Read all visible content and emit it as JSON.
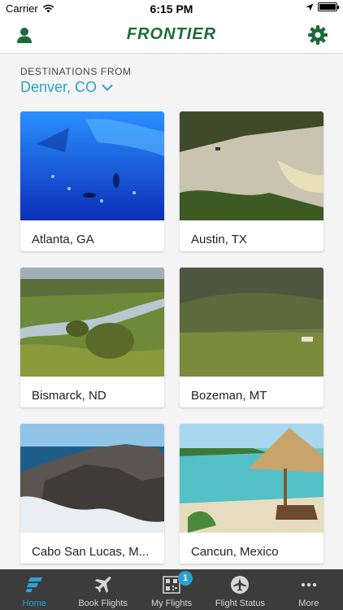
{
  "status_bar": {
    "carrier": "Carrier",
    "time": "6:15 PM"
  },
  "nav": {
    "logo": "FRONTIER"
  },
  "destinations": {
    "from_label": "DESTINATIONS FROM",
    "city": "Denver, CO",
    "cards": [
      {
        "name": "Atlanta, GA"
      },
      {
        "name": "Austin, TX"
      },
      {
        "name": "Bismarck, ND"
      },
      {
        "name": "Bozeman, MT"
      },
      {
        "name": "Cabo San Lucas, M..."
      },
      {
        "name": "Cancun, Mexico"
      }
    ]
  },
  "tabs": [
    {
      "label": "Home"
    },
    {
      "label": "Book Flights"
    },
    {
      "label": "My Flights",
      "badge": "1"
    },
    {
      "label": "Flight Status"
    },
    {
      "label": "More"
    }
  ],
  "colors": {
    "brand_green": "#1b6b3a",
    "accent_blue": "#28a3c5",
    "tab_bar": "#3c3c3c"
  }
}
